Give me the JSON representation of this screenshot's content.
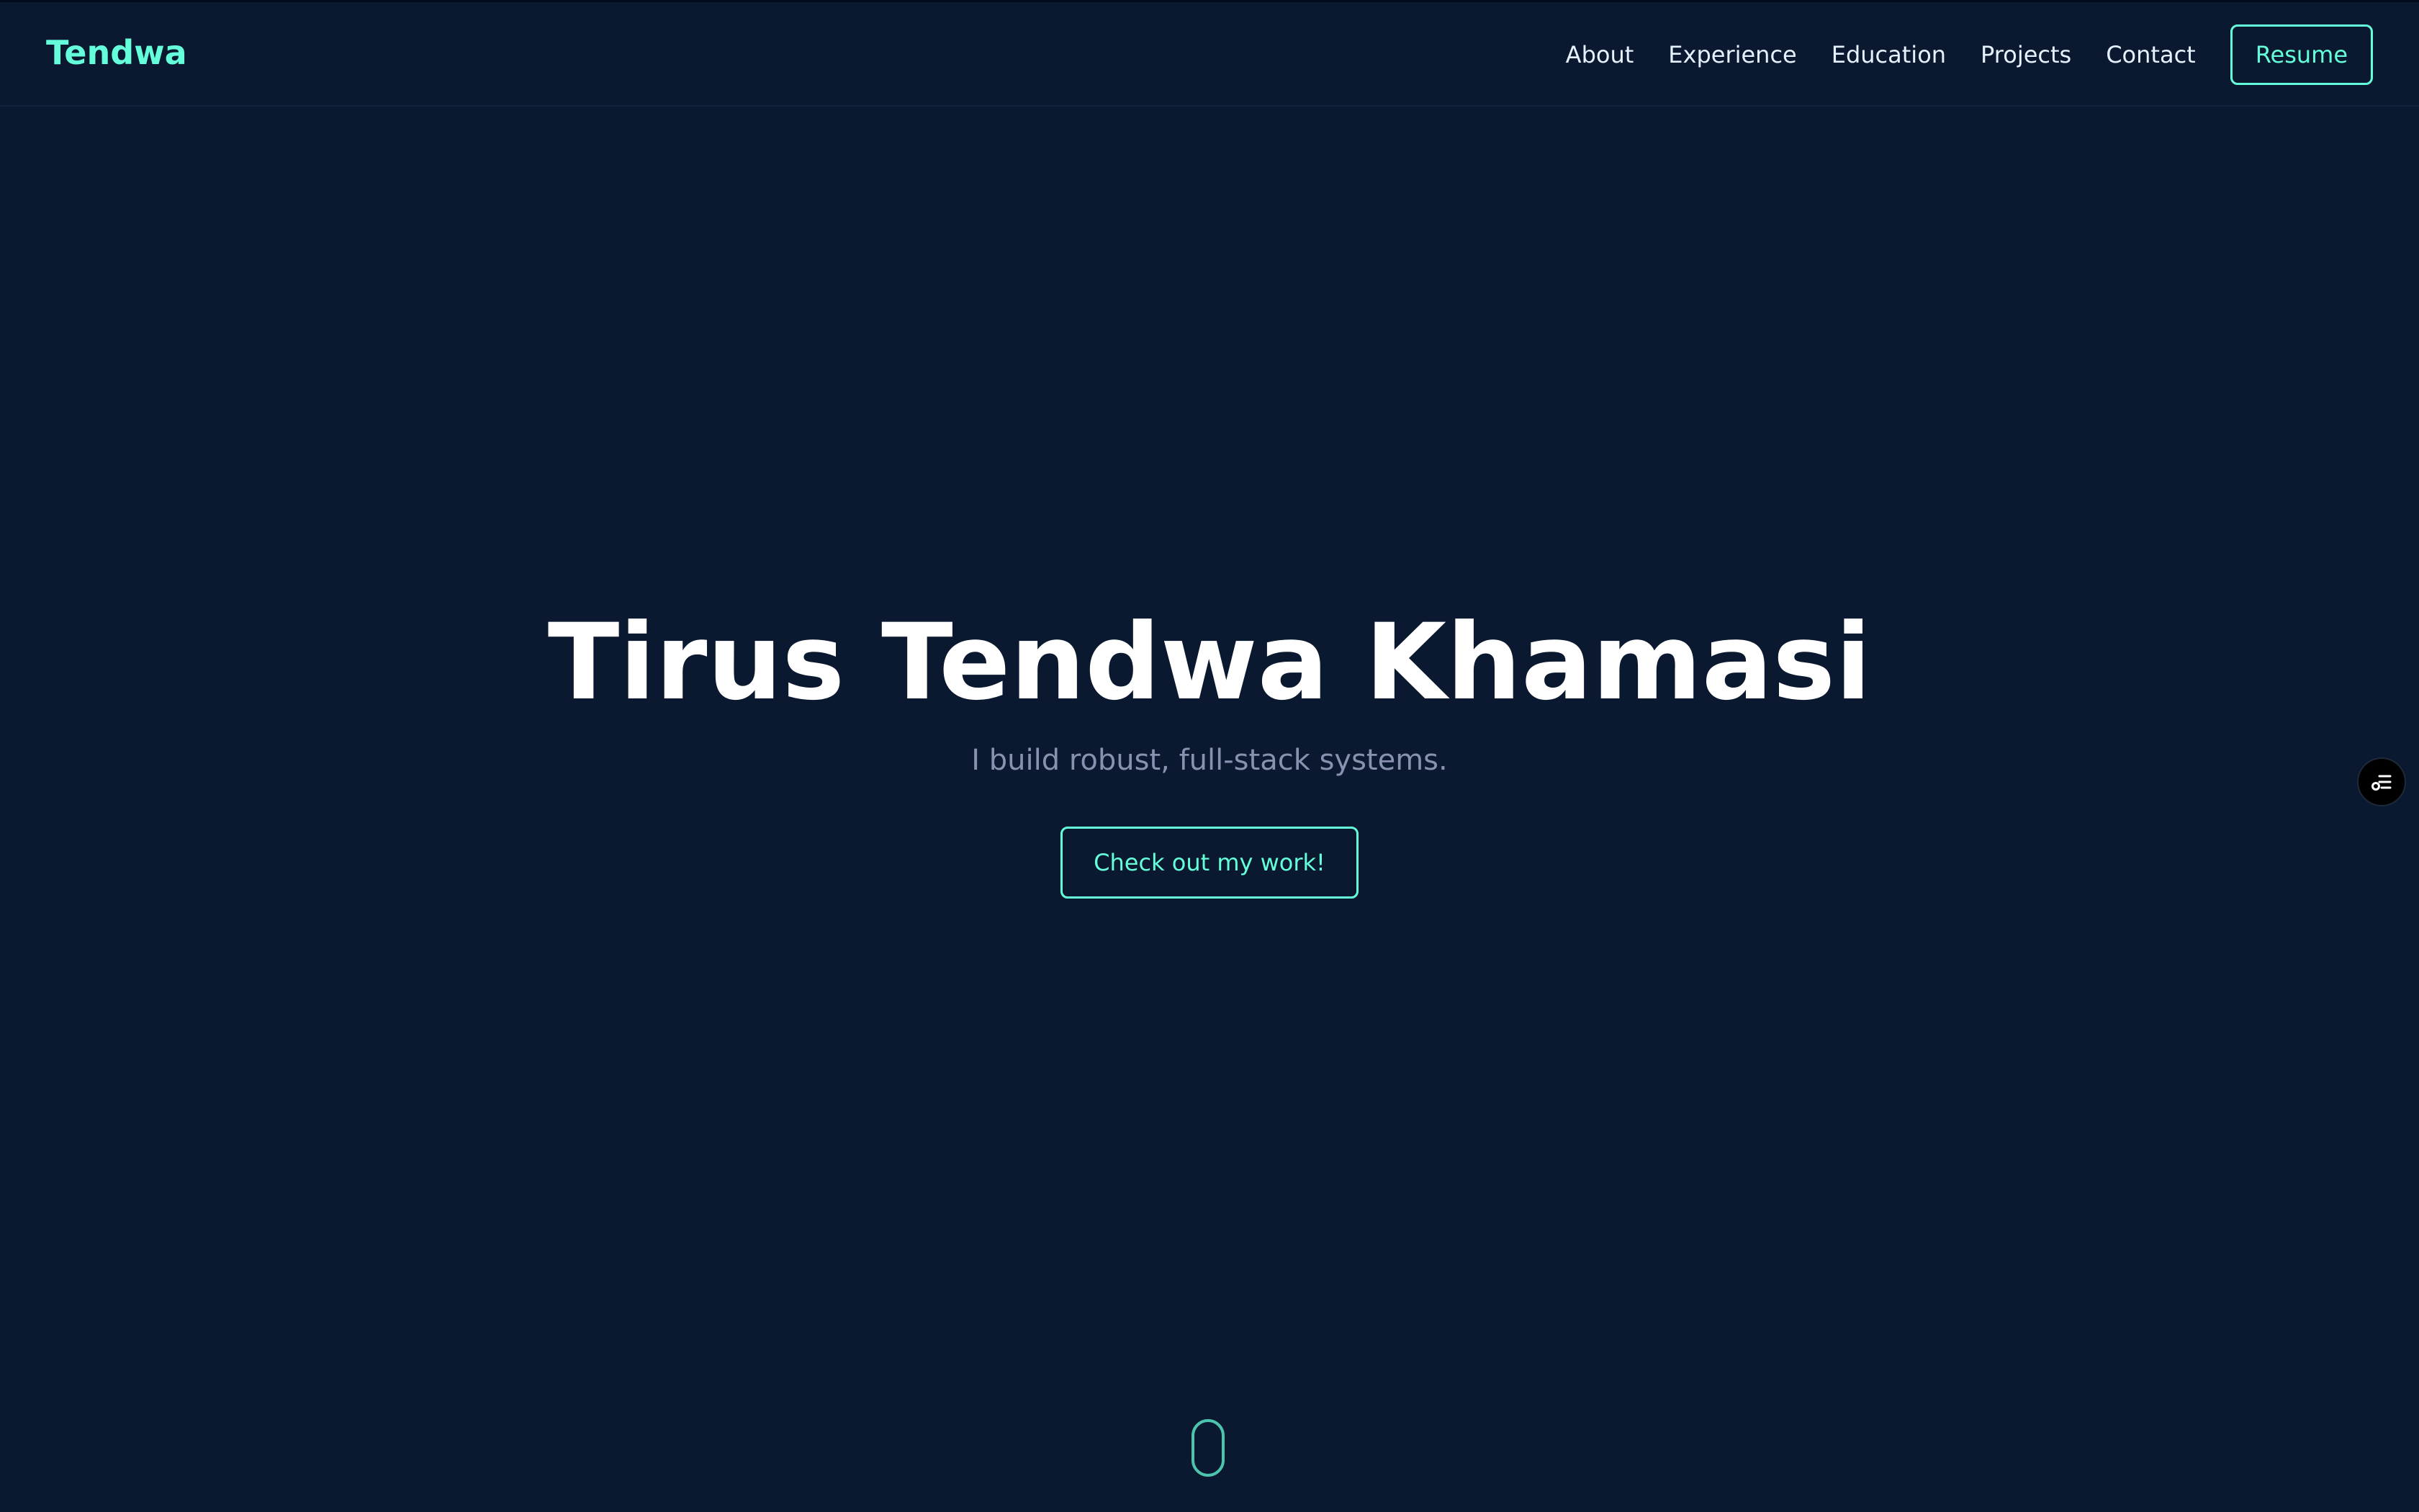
{
  "header": {
    "logo": "Tendwa",
    "nav": [
      {
        "label": "About"
      },
      {
        "label": "Experience"
      },
      {
        "label": "Education"
      },
      {
        "label": "Projects"
      },
      {
        "label": "Contact"
      }
    ],
    "resume_label": "Resume"
  },
  "hero": {
    "name": "Tirus Tendwa Khamasi",
    "tagline": "I build robust, full-stack systems.",
    "cta_label": "Check out my work!"
  },
  "widgets": {
    "side_icon": "settings-list-icon",
    "scroll_icon": "mouse-scroll-icon"
  },
  "colors": {
    "background": "#0a192f",
    "accent": "#64ffda",
    "heading": "#ffffff",
    "nav_text": "#e6f1ff",
    "muted_text": "#8892b0"
  }
}
